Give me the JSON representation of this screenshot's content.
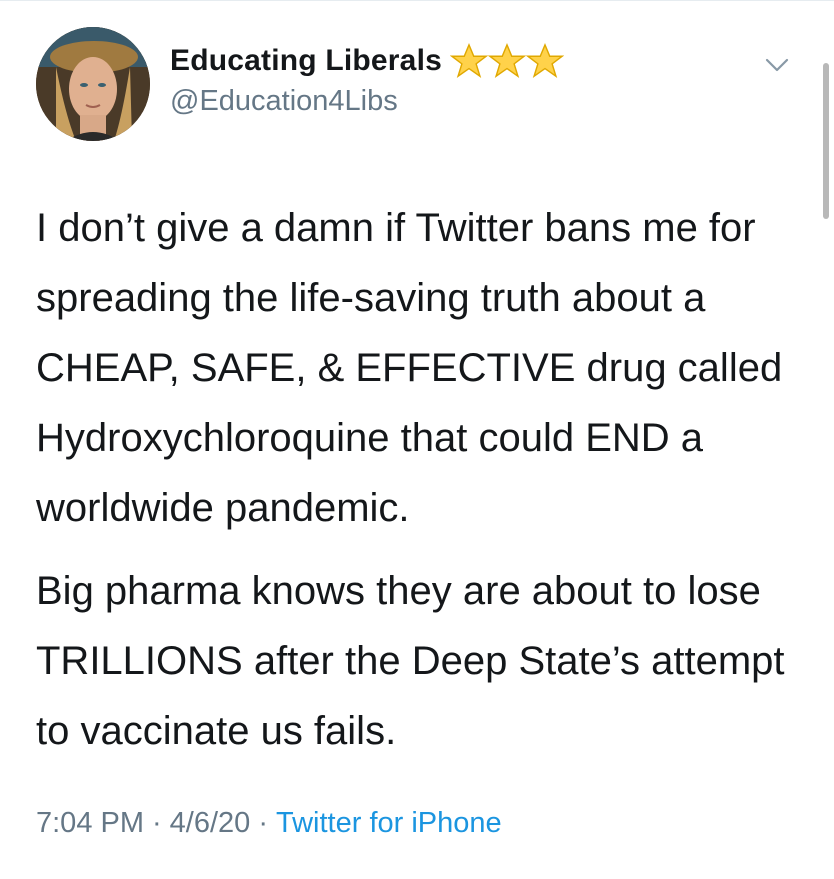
{
  "tweet": {
    "display_name": "Educating Liberals",
    "handle": "@Education4Libs",
    "badge_icons": [
      "star-icon",
      "star-icon",
      "star-icon"
    ],
    "paragraphs": [
      "I don’t give a damn if Twitter bans me for spreading the life-saving truth about a CHEAP, SAFE, & EFFECTIVE drug called Hydroxychloroquine that could END a worldwide pandemic.",
      "Big pharma knows they are about to lose TRILLIONS after the Deep State’s attempt to vaccinate us fails."
    ],
    "time": "7:04 PM",
    "separator": "·",
    "date": "4/6/20",
    "source": "Twitter for iPhone"
  },
  "colors": {
    "text": "#14171a",
    "secondary": "#657786",
    "link": "#1b95e0",
    "star_fill": "#ffd24a",
    "star_stroke": "#e0a800"
  },
  "icons": {
    "menu": "chevron-down-icon"
  }
}
